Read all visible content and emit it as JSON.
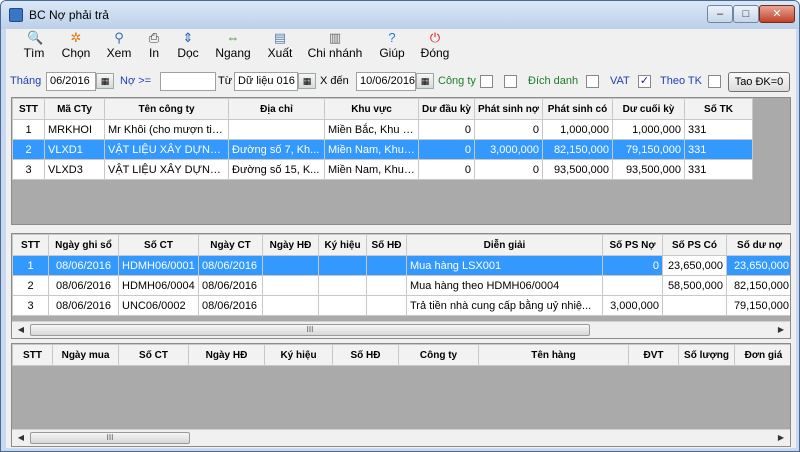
{
  "window": {
    "title": "BC Nợ phải trả",
    "min": "–",
    "max": "□",
    "close": "✕"
  },
  "toolbar": [
    {
      "label": "Tìm",
      "icon": "search-icon",
      "glyph": "🔍",
      "color": "#2a62b8"
    },
    {
      "label": "Chọn",
      "icon": "gear-icon",
      "glyph": "✲",
      "color": "#e07a10"
    },
    {
      "label": "Xem",
      "icon": "view-icon",
      "glyph": "⚲",
      "color": "#3a6ea8"
    },
    {
      "label": "In",
      "icon": "printer-icon",
      "glyph": "⎙",
      "color": "#333333"
    },
    {
      "label": "Dọc",
      "icon": "vertical-arrows-icon",
      "glyph": "⇕",
      "color": "#2a62b8"
    },
    {
      "label": "Ngang",
      "icon": "horizontal-arrows-icon",
      "glyph": "⇔",
      "color": "#2f8a2f"
    },
    {
      "label": "Xuất",
      "icon": "export-icon",
      "glyph": "▤",
      "color": "#5a7fb0"
    },
    {
      "label": "Chi nhánh",
      "icon": "building-icon",
      "glyph": "▥",
      "color": "#6a6a6a"
    },
    {
      "label": "Giúp",
      "icon": "help-icon",
      "glyph": "?",
      "color": "#1f7ad0"
    },
    {
      "label": "Đóng",
      "icon": "power-icon",
      "glyph": "⏻",
      "color": "#d02020"
    }
  ],
  "filter": {
    "thang_label": "Tháng",
    "thang_value": "06/2016",
    "no_label": "Nợ >=",
    "no_value": "",
    "tu_label": "Từ",
    "tu_value": "Dữ liệu 016",
    "den_label": "X đến",
    "den_value": "10/06/2016",
    "congty_label": "Công ty",
    "dichdanh_label": "Đích danh",
    "vat_label": "VAT",
    "vat_checked": "✓",
    "theotk_label": "Theo TK",
    "taodk_label": "Tao ĐK=0"
  },
  "grid1": {
    "columns": [
      "STT",
      "Mã CTy",
      "Tên công ty",
      "Địa chỉ",
      "Khu vực",
      "Dư đầu kỳ",
      "Phát sinh nợ",
      "Phát sinh có",
      "Dư cuối kỳ",
      "Số TK"
    ],
    "rows": [
      [
        "1",
        "MRKHOI",
        "Mr Khôi (cho mượn tiền)",
        "",
        "Miền Bắc, Khu vực",
        "0",
        "0",
        "1,000,000",
        "1,000,000",
        "331"
      ],
      [
        "2",
        "VLXD1",
        "VẬT LIỆU XÂY DỰNG 1",
        "Đường số 7, Kh...",
        "Miền Nam, Khu v...",
        "0",
        "3,000,000",
        "82,150,000",
        "79,150,000",
        "331"
      ],
      [
        "3",
        "VLXD3",
        "VẬT LIỆU XÂY DỰNG 3",
        "Đường số 15, K...",
        "Miền Nam, Khu v...",
        "0",
        "0",
        "93,500,000",
        "93,500,000",
        "331"
      ]
    ]
  },
  "grid2": {
    "columns": [
      "STT",
      "Ngày ghi sổ",
      "Số CT",
      "Ngày CT",
      "Ngày HĐ",
      "Ký hiệu",
      "Số HĐ",
      "Diễn giải",
      "Số PS Nợ",
      "Số PS Có",
      "Số dư nợ"
    ],
    "rows": [
      [
        "1",
        "08/06/2016",
        "HDMH06/0001",
        "08/06/2016",
        "",
        "",
        "",
        "Mua hàng LSX001",
        "0",
        "23,650,000",
        "23,650,000"
      ],
      [
        "2",
        "08/06/2016",
        "HDMH06/0004",
        "08/06/2016",
        "",
        "",
        "",
        "Mua hàng theo HDMH06/0004",
        "",
        "58,500,000",
        "82,150,000"
      ],
      [
        "3",
        "08/06/2016",
        "UNC06/0002",
        "08/06/2016",
        "",
        "",
        "",
        "Trả tiền nhà cung cấp bằng uỷ nhiệ...",
        "3,000,000",
        "",
        "79,150,000"
      ]
    ],
    "scroll_thumb": "III"
  },
  "grid3": {
    "columns": [
      "STT",
      "Ngày mua",
      "Số CT",
      "Ngày HĐ",
      "Ký hiệu",
      "Số HĐ",
      "Công ty",
      "Tên hàng",
      "ĐVT",
      "Số lượng",
      "Đơn giá"
    ],
    "scroll_thumb": "III"
  }
}
